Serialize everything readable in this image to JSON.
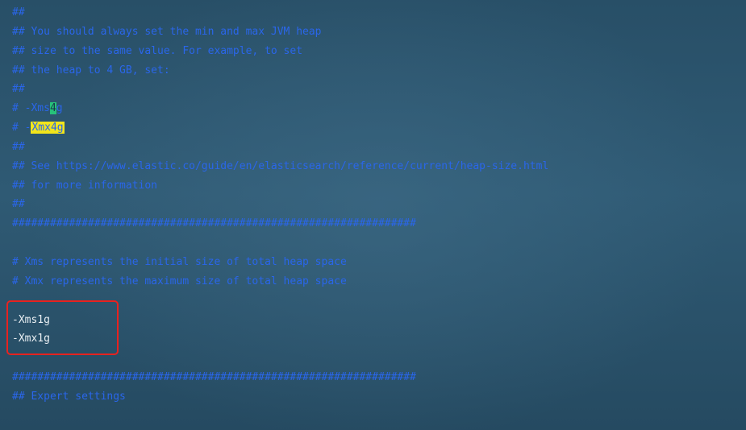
{
  "editor": {
    "lines": {
      "l1": "##",
      "l2": "## You should always set the min and max JVM heap",
      "l3": "## size to the same value. For example, to set",
      "l4": "## the heap to 4 GB, set:",
      "l5": "##",
      "l6_prefix": "# -Xms",
      "l6_cursor": "4",
      "l6_suffix": "g",
      "l7_prefix": "# -",
      "l7_highlight": "Xmx4g",
      "l8": "##",
      "l9": "## See https://www.elastic.co/guide/en/elasticsearch/reference/current/heap-size.html",
      "l10": "## for more information",
      "l11": "##",
      "l12": "################################################################",
      "l14": "# Xms represents the initial size of total heap space",
      "l15": "# Xmx represents the maximum size of total heap space",
      "l17": "-Xms1g",
      "l18": "-Xmx1g",
      "l20": "################################################################",
      "l21": "## Expert settings"
    }
  },
  "colors": {
    "comment": "#2a66ea",
    "option": "#e8eef2",
    "highlight": "#f2e51b",
    "cursor": "#27c27a",
    "annotation_box": "#e8221f"
  }
}
